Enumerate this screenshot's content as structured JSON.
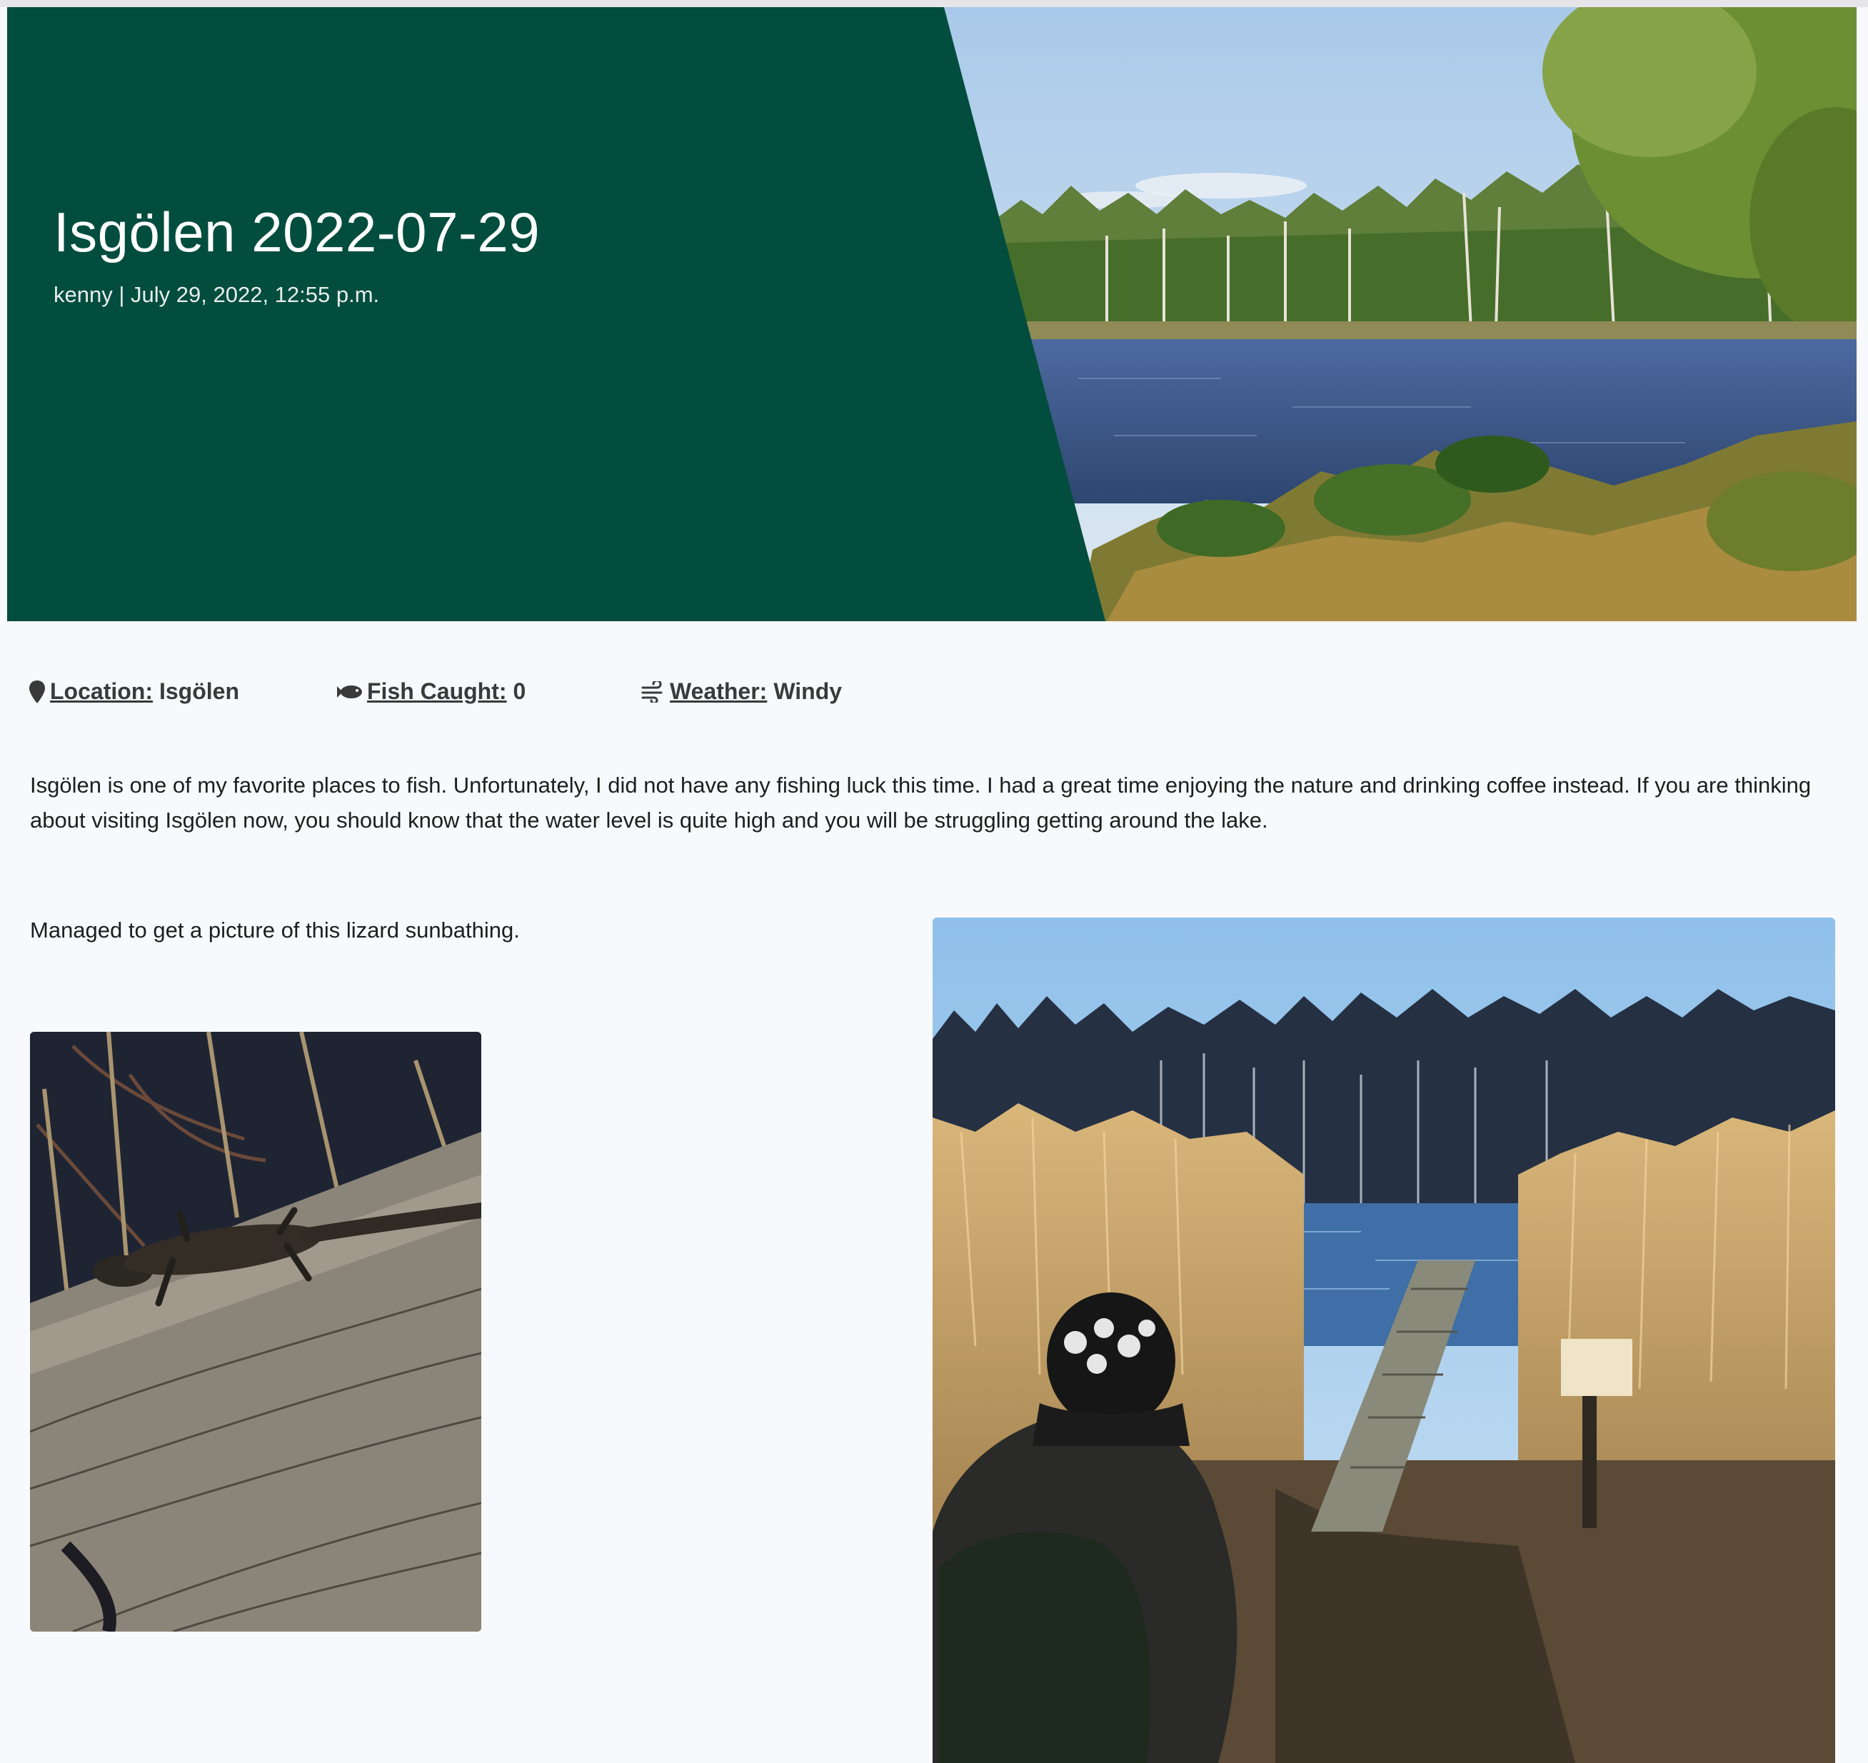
{
  "header": {
    "title": "Isgölen 2022-07-29",
    "author": "kenny",
    "separator": "|",
    "date": "July 29, 2022, 12:55 p.m.",
    "bg_color": "#024d3e"
  },
  "facts": {
    "location": {
      "label": "Location:",
      "value": "Isgölen",
      "icon": "map-pin-icon"
    },
    "fish": {
      "label": "Fish Caught:",
      "value": "0",
      "icon": "fish-icon"
    },
    "weather": {
      "label": "Weather:",
      "value": "Windy",
      "icon": "wind-icon"
    }
  },
  "body": {
    "paragraph": "Isgölen is one of my favorite places to fish. Unfortunately, I did not have any fishing luck this time. I had a great time enjoying the nature and drinking coffee instead. If you are thinking about visiting Isgölen now, you should know that the water level is quite high and you will be struggling getting around the lake.",
    "caption": "Managed to get a picture of this lizard sunbathing."
  },
  "images": {
    "hero": "summer lake with birch forest",
    "lizard": "lizard on weathered wooden board",
    "lake": "person with backpack at wooden jetty among reeds"
  }
}
